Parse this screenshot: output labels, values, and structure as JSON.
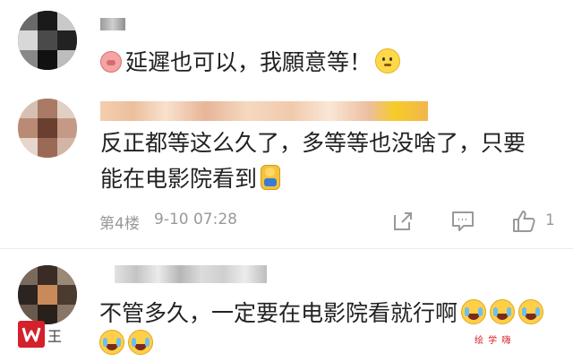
{
  "comments": [
    {
      "text": "延遲也可以，我願意等！"
    },
    {
      "text_line1": "反正都等这么久了，多等等也没啥了，只要",
      "text_line2": "能在电影院看到",
      "floor": "第4楼",
      "time": "9-10 07:28",
      "like_count": "1"
    },
    {
      "text_line1": "不管多久，一定要在电影院看就行啊",
      "watermark_label": "王",
      "watermark_small": "绘 学 嗨"
    }
  ],
  "icons": {
    "share": "share-icon",
    "reply": "comment-icon",
    "like": "thumbs-up-icon"
  },
  "colors": {
    "meta_gray": "#999999",
    "watermark_red": "#d4212b"
  }
}
